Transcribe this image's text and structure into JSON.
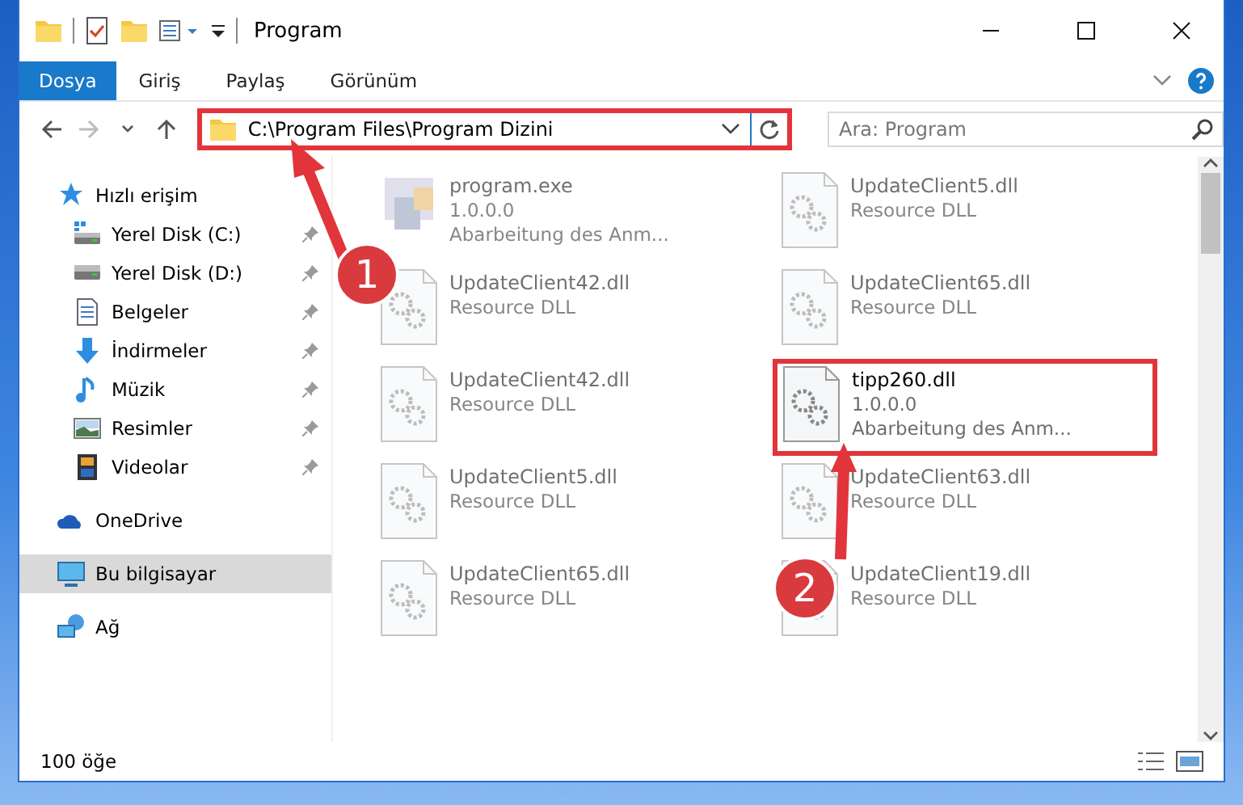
{
  "window": {
    "title": "Program"
  },
  "ribbon": {
    "tabs": [
      {
        "label": "Dosya",
        "kind": "file",
        "selected": false
      },
      {
        "label": "Giriş",
        "kind": "tab",
        "selected": false
      },
      {
        "label": "Paylaş",
        "kind": "tab",
        "selected": false
      },
      {
        "label": "Görünüm",
        "kind": "tab",
        "selected": false
      }
    ]
  },
  "address_bar": {
    "path": "C:\\Program Files\\Program Dizini",
    "highlighted": true
  },
  "search": {
    "placeholder": "Ara: Program"
  },
  "navigation": {
    "items": [
      {
        "label": "Hızlı erişim",
        "kind": "quick",
        "selected": false,
        "children": [
          {
            "label": "Yerel Disk (C:)",
            "kind": "disk-c",
            "pinned": true,
            "selected": false
          },
          {
            "label": "Yerel Disk (D:)",
            "kind": "disk",
            "pinned": true,
            "selected": false
          },
          {
            "label": "Belgeler",
            "kind": "documents",
            "pinned": true,
            "selected": false
          },
          {
            "label": "İndirmeler",
            "kind": "downloads",
            "pinned": true,
            "selected": false
          },
          {
            "label": "Müzik",
            "kind": "music",
            "pinned": true,
            "selected": false
          },
          {
            "label": "Resimler",
            "kind": "pictures",
            "pinned": true,
            "selected": false
          },
          {
            "label": "Videolar",
            "kind": "videos",
            "pinned": true,
            "selected": false
          }
        ]
      },
      {
        "label": "OneDrive",
        "kind": "cloud",
        "selected": false
      },
      {
        "label": "Bu bilgisayar",
        "kind": "computer",
        "selected": true
      },
      {
        "label": "Ağ",
        "kind": "network",
        "selected": false
      }
    ]
  },
  "files": [
    {
      "name": "program.exe",
      "kind": "exe",
      "details": [
        "1.0.0.0",
        "Abarbeitung des Anm..."
      ],
      "blurred": true,
      "highlighted": false
    },
    {
      "name": "UpdateClient5.dll",
      "kind": "dll",
      "details": [
        "Resource DLL"
      ],
      "blurred": true,
      "highlighted": false
    },
    {
      "name": "UpdateClient42.dll",
      "kind": "dll",
      "details": [
        "Resource DLL"
      ],
      "blurred": true,
      "highlighted": false
    },
    {
      "name": "UpdateClient65.dll",
      "kind": "dll",
      "details": [
        "Resource DLL"
      ],
      "blurred": true,
      "highlighted": false
    },
    {
      "name": "UpdateClient42.dll",
      "kind": "dll",
      "details": [
        "Resource DLL"
      ],
      "blurred": true,
      "highlighted": false
    },
    {
      "name": "tipp260.dll",
      "kind": "dll",
      "details": [
        "1.0.0.0",
        "Abarbeitung des Anm..."
      ],
      "blurred": false,
      "highlighted": true
    },
    {
      "name": "UpdateClient5.dll",
      "kind": "dll",
      "details": [
        "Resource DLL"
      ],
      "blurred": true,
      "highlighted": false
    },
    {
      "name": "UpdateClient63.dll",
      "kind": "dll",
      "details": [
        "Resource DLL"
      ],
      "blurred": true,
      "highlighted": false
    },
    {
      "name": "UpdateClient65.dll",
      "kind": "dll",
      "details": [
        "Resource DLL"
      ],
      "blurred": true,
      "highlighted": false
    },
    {
      "name": "UpdateClient19.dll",
      "kind": "dll",
      "details": [
        "Resource DLL"
      ],
      "blurred": true,
      "highlighted": false
    }
  ],
  "status_bar": {
    "item_count": "100 öğe"
  },
  "annotations": [
    {
      "number": "1"
    },
    {
      "number": "2"
    }
  ]
}
